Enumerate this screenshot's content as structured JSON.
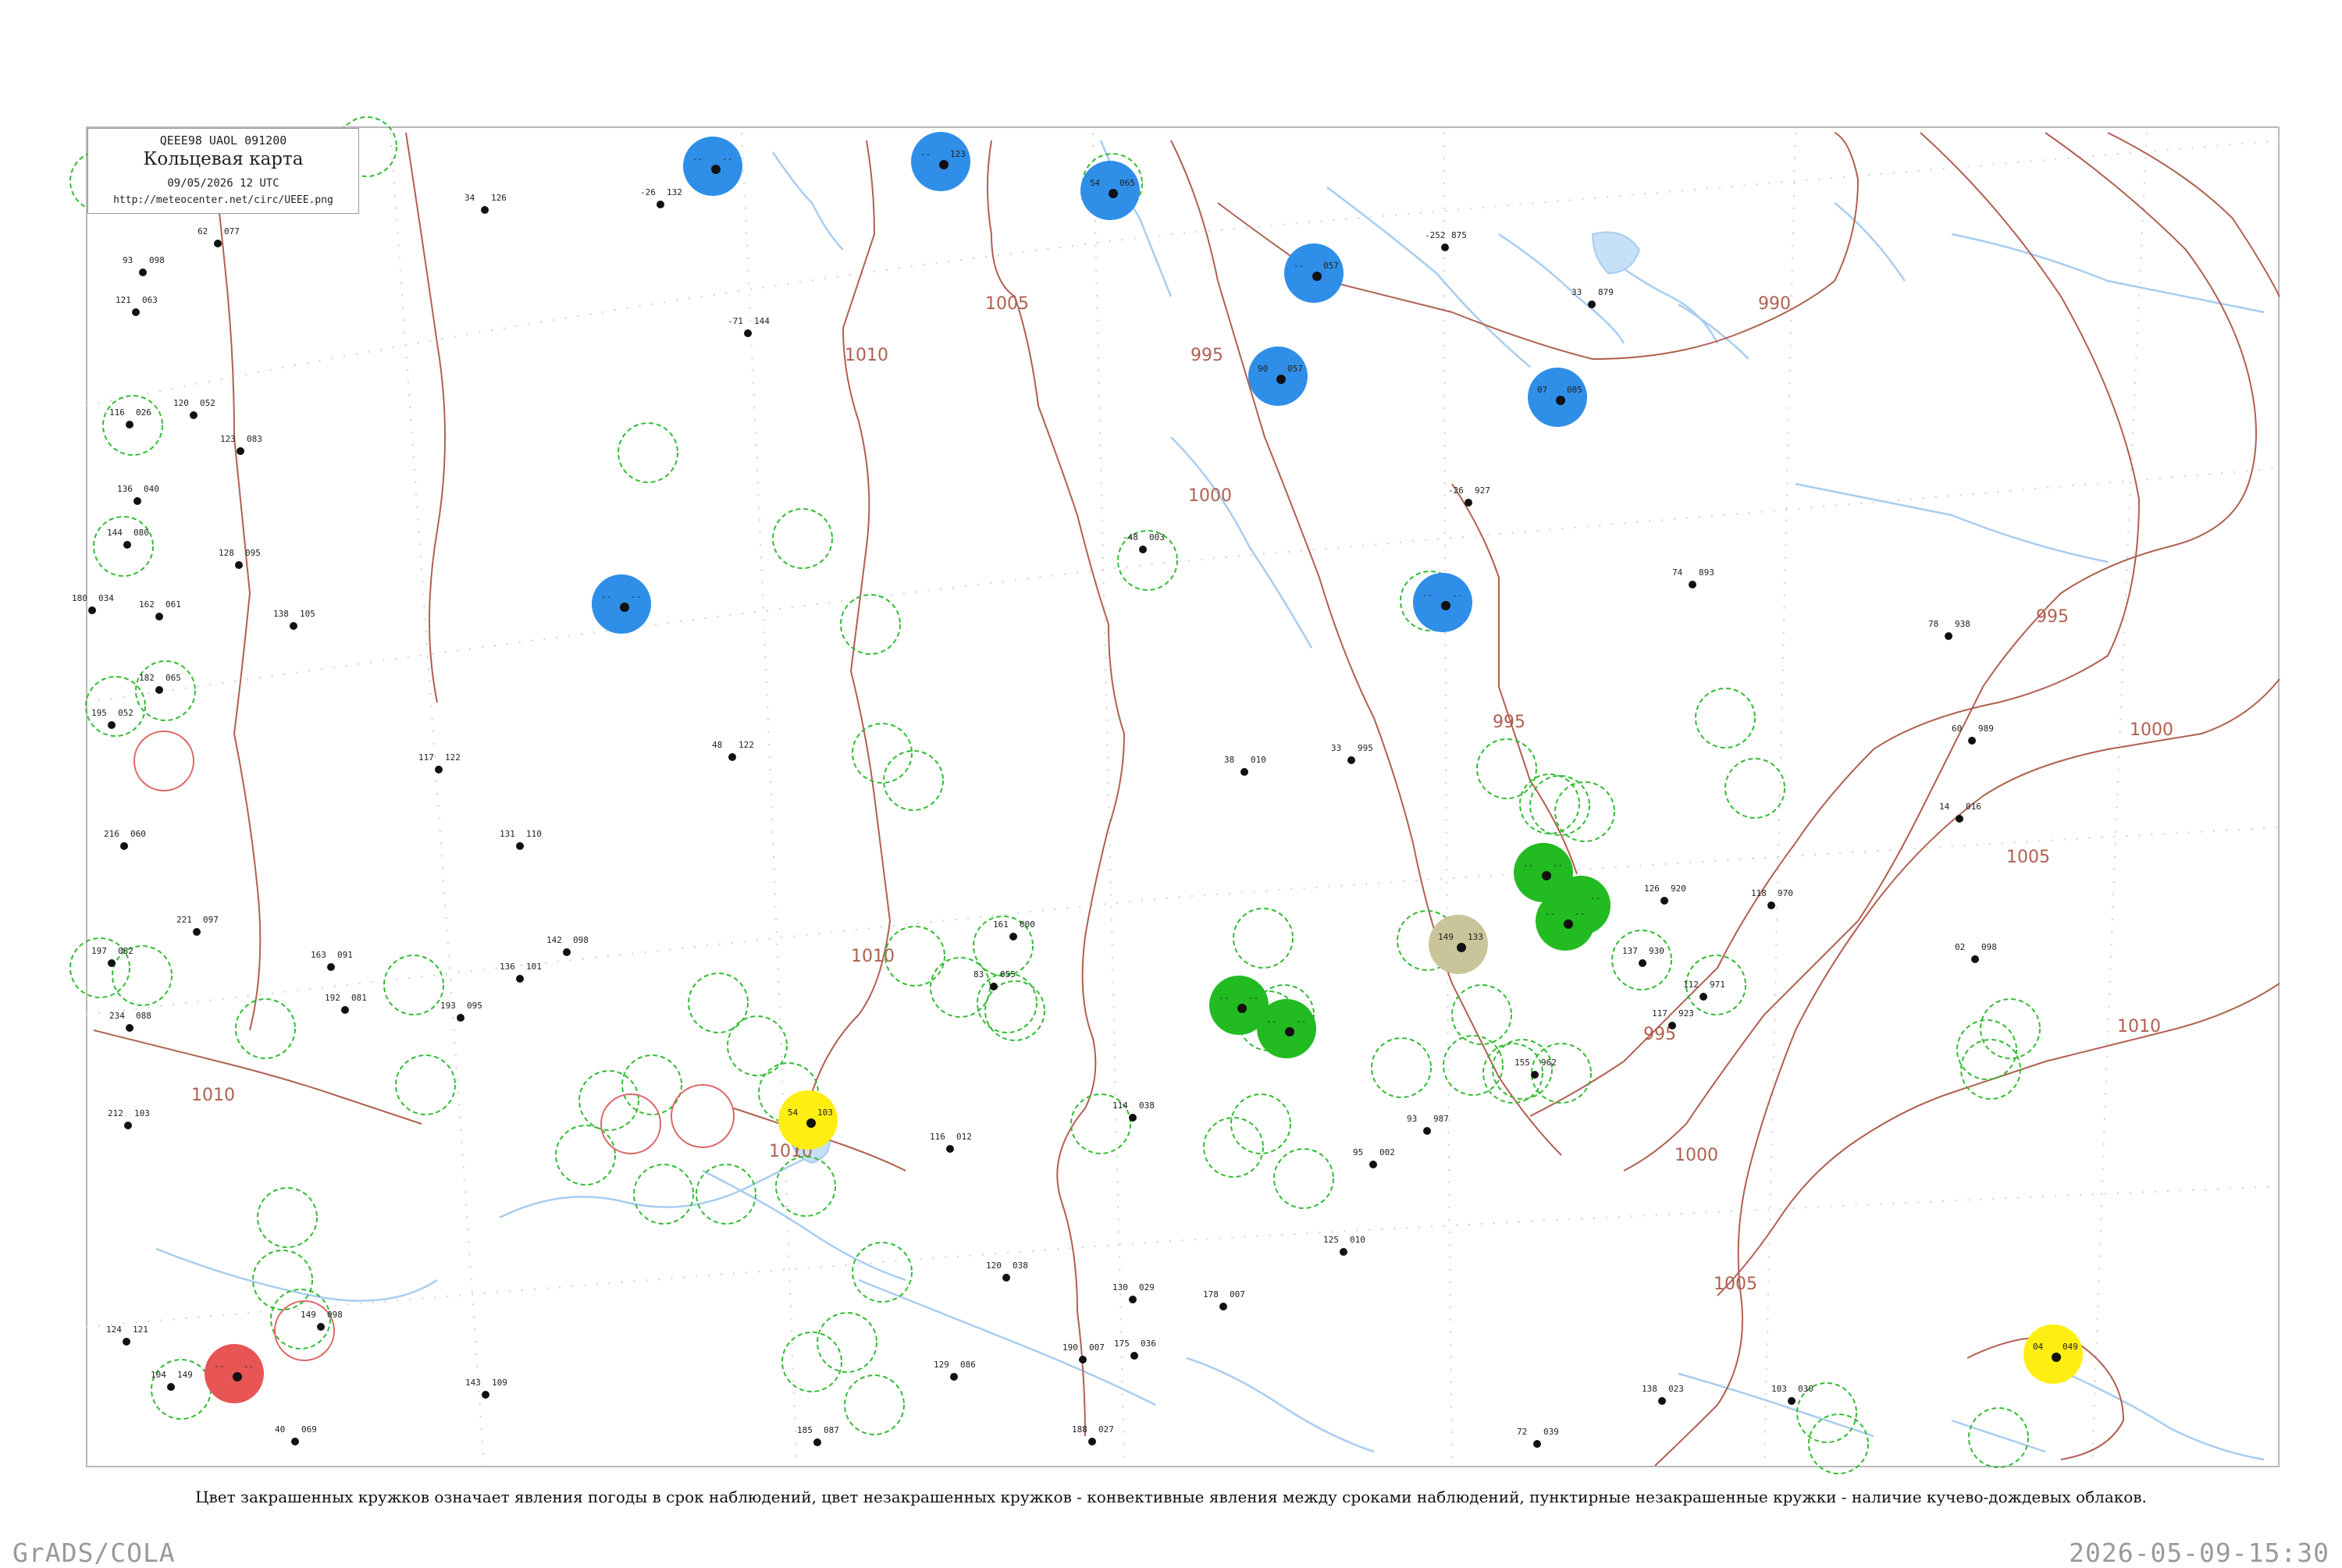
{
  "header": {
    "code_line": "QEEE98  UAOL  091200",
    "title": "Кольцевая карта",
    "date_line": "09/05/2026 12 UTC",
    "url": "http://meteocenter.net/circ/UEEE.png"
  },
  "caption": "Цвет закрашенных кружков означает явления погоды в срок наблюдений, цвет незакрашенных кружков - конвективные явления между сроками наблюдений, пунктирные незакрашенные кружки - наличие кучево-дождевых облаков.",
  "footer": {
    "left": "GrADS/COLA",
    "right": "2026-05-09-15:30"
  },
  "colors": {
    "isobar": "#b06050",
    "river": "#a8cdf0",
    "fill_blue": "#2f8fe8",
    "fill_green": "#22bb22",
    "fill_yellow": "#ffee11",
    "fill_red": "#e85555",
    "fill_khaki": "#c9c49a",
    "dashed_ring": "#33bb33",
    "convective_ring": "#dd6666"
  },
  "isobar_labels": [
    {
      "id": "iso-1005-a",
      "text": "1005"
    },
    {
      "id": "iso-1010-a",
      "text": "1010"
    },
    {
      "id": "iso-995-a",
      "text": "995"
    },
    {
      "id": "iso-990",
      "text": "990"
    },
    {
      "id": "iso-1000-a",
      "text": "1000"
    },
    {
      "id": "iso-995-b",
      "text": "995"
    },
    {
      "id": "iso-995-c",
      "text": "995"
    },
    {
      "id": "iso-1000-b",
      "text": "1000"
    },
    {
      "id": "iso-1005-b",
      "text": "1005"
    },
    {
      "id": "iso-1010-b",
      "text": "1010"
    },
    {
      "id": "iso-1010-c",
      "text": "1010"
    },
    {
      "id": "iso-1010-d",
      "text": "1010"
    },
    {
      "id": "iso-1000-c",
      "text": "1000"
    },
    {
      "id": "iso-1005-c",
      "text": "1005"
    },
    {
      "id": "iso-1010-e",
      "text": "1010"
    },
    {
      "id": "iso-995-d",
      "text": "995"
    }
  ],
  "stations": [
    {
      "id": "st-blue-1",
      "type": "filled",
      "color": "blue",
      "values": [
        "--",
        "--"
      ]
    },
    {
      "id": "st-blue-2",
      "type": "filled",
      "color": "blue",
      "values": [
        "--",
        "123"
      ]
    },
    {
      "id": "st-blue-3",
      "type": "filled",
      "color": "blue",
      "values": [
        "54",
        "065"
      ]
    },
    {
      "id": "st-blue-4",
      "type": "filled",
      "color": "blue",
      "values": [
        "--",
        "057"
      ]
    },
    {
      "id": "st-blue-5",
      "type": "filled",
      "color": "blue",
      "values": [
        "90",
        "057"
      ]
    },
    {
      "id": "st-blue-6",
      "type": "filled",
      "color": "blue",
      "values": [
        "07",
        "085"
      ]
    },
    {
      "id": "st-blue-7",
      "type": "filled",
      "color": "blue",
      "values": [
        "--",
        "--"
      ]
    },
    {
      "id": "st-blue-8",
      "type": "filled",
      "color": "blue",
      "values": [
        "--",
        "--"
      ]
    },
    {
      "id": "st-green-1",
      "type": "filled",
      "color": "green",
      "values": [
        "--",
        "--"
      ]
    },
    {
      "id": "st-green-2",
      "type": "filled",
      "color": "green",
      "values": [
        "--",
        "--"
      ]
    },
    {
      "id": "st-green-3",
      "type": "filled",
      "color": "green",
      "values": [
        "--",
        "--"
      ]
    },
    {
      "id": "st-green-4",
      "type": "filled",
      "color": "green",
      "values": [
        "--",
        "--"
      ]
    },
    {
      "id": "st-green-5",
      "type": "filled",
      "color": "green",
      "values": [
        "--",
        "--"
      ]
    },
    {
      "id": "st-yellow-1",
      "type": "filled",
      "color": "yellow",
      "values": [
        "54",
        "103"
      ]
    },
    {
      "id": "st-yellow-2",
      "type": "filled",
      "color": "yellow",
      "values": [
        "04",
        "049"
      ]
    },
    {
      "id": "st-red-1",
      "type": "filled",
      "color": "red",
      "values": [
        "--",
        "--"
      ]
    },
    {
      "id": "st-khaki-1",
      "type": "filled",
      "color": "khaki",
      "values": [
        "149",
        "133"
      ]
    }
  ],
  "station_numbers": [
    {
      "id": "sn-1",
      "top": "-26",
      "right": "132"
    },
    {
      "id": "sn-2",
      "top": "34",
      "right": "126"
    },
    {
      "id": "sn-3",
      "top": "62",
      "right": "077"
    },
    {
      "id": "sn-4",
      "top": "93",
      "right": "098"
    },
    {
      "id": "sn-5",
      "top": "121",
      "right": "063"
    },
    {
      "id": "sn-6",
      "top": "116",
      "right": "026"
    },
    {
      "id": "sn-7",
      "top": "120",
      "right": "052"
    },
    {
      "id": "sn-8",
      "top": "123",
      "right": "083"
    },
    {
      "id": "sn-9",
      "top": "136",
      "right": "040"
    },
    {
      "id": "sn-10",
      "top": "144",
      "right": "080"
    },
    {
      "id": "sn-11",
      "top": "128",
      "right": "095"
    },
    {
      "id": "sn-12",
      "top": "180",
      "right": "034"
    },
    {
      "id": "sn-13",
      "top": "162",
      "right": "061"
    },
    {
      "id": "sn-14",
      "top": "138",
      "right": "105"
    },
    {
      "id": "sn-15",
      "top": "182",
      "right": "065"
    },
    {
      "id": "sn-16",
      "top": "195",
      "right": "052"
    },
    {
      "id": "sn-17",
      "top": "216",
      "right": "060"
    },
    {
      "id": "sn-18",
      "top": "197",
      "right": "082"
    },
    {
      "id": "sn-19",
      "top": "234",
      "right": "088"
    },
    {
      "id": "sn-20",
      "top": "212",
      "right": "103"
    },
    {
      "id": "sn-21",
      "top": "221",
      "right": "097"
    },
    {
      "id": "sn-22",
      "top": "163",
      "right": "091"
    },
    {
      "id": "sn-23",
      "top": "192",
      "right": "081"
    },
    {
      "id": "sn-24",
      "top": "193",
      "right": "095"
    },
    {
      "id": "sn-25",
      "top": "136",
      "right": "101"
    },
    {
      "id": "sn-26",
      "top": "142",
      "right": "098"
    },
    {
      "id": "sn-27",
      "top": "131",
      "right": "110"
    },
    {
      "id": "sn-28",
      "top": "117",
      "right": "122"
    },
    {
      "id": "sn-29",
      "top": "48",
      "right": "122"
    },
    {
      "id": "sn-30",
      "top": "-71",
      "right": "144"
    },
    {
      "id": "sn-31",
      "top": "-48",
      "right": "003"
    },
    {
      "id": "sn-32",
      "top": "38",
      "right": "010"
    },
    {
      "id": "sn-33",
      "top": "33",
      "right": "995"
    },
    {
      "id": "sn-34",
      "top": "-26",
      "right": "927"
    },
    {
      "id": "sn-35",
      "top": "-252",
      "right": "875"
    },
    {
      "id": "sn-36",
      "top": "33",
      "right": "879"
    },
    {
      "id": "sn-37",
      "top": "74",
      "right": "893"
    },
    {
      "id": "sn-38",
      "top": "78",
      "right": "938"
    },
    {
      "id": "sn-39",
      "top": "60",
      "right": "989"
    },
    {
      "id": "sn-40",
      "top": "14",
      "right": "016"
    },
    {
      "id": "sn-41",
      "top": "02",
      "right": "098"
    },
    {
      "id": "sn-42",
      "top": "126",
      "right": "920"
    },
    {
      "id": "sn-43",
      "top": "118",
      "right": "970"
    },
    {
      "id": "sn-44",
      "top": "137",
      "right": "930"
    },
    {
      "id": "sn-45",
      "top": "112",
      "right": "971"
    },
    {
      "id": "sn-46",
      "top": "117",
      "right": "923"
    },
    {
      "id": "sn-47",
      "top": "155",
      "right": "962"
    },
    {
      "id": "sn-48",
      "top": "93",
      "right": "987"
    },
    {
      "id": "sn-49",
      "top": "95",
      "right": "002"
    },
    {
      "id": "sn-50",
      "top": "125",
      "right": "010"
    },
    {
      "id": "sn-51",
      "top": "161",
      "right": "000"
    },
    {
      "id": "sn-52",
      "top": "83",
      "right": "055"
    },
    {
      "id": "sn-53",
      "top": "114",
      "right": "038"
    },
    {
      "id": "sn-54",
      "top": "116",
      "right": "012"
    },
    {
      "id": "sn-55",
      "top": "120",
      "right": "038"
    },
    {
      "id": "sn-56",
      "top": "130",
      "right": "029"
    },
    {
      "id": "sn-57",
      "top": "178",
      "right": "007"
    },
    {
      "id": "sn-58",
      "top": "190",
      "right": "007"
    },
    {
      "id": "sn-59",
      "top": "188",
      "right": "027"
    },
    {
      "id": "sn-60",
      "top": "175",
      "right": "036"
    },
    {
      "id": "sn-61",
      "top": "138",
      "right": "023"
    },
    {
      "id": "sn-62",
      "top": "72",
      "right": "039"
    },
    {
      "id": "sn-63",
      "top": "103",
      "right": "030"
    },
    {
      "id": "sn-64",
      "top": "40",
      "right": "069"
    },
    {
      "id": "sn-65",
      "top": "149",
      "right": "098"
    },
    {
      "id": "sn-66",
      "top": "104",
      "right": "149"
    },
    {
      "id": "sn-67",
      "top": "124",
      "right": "121"
    },
    {
      "id": "sn-68",
      "top": "143",
      "right": "109"
    },
    {
      "id": "sn-69",
      "top": "185",
      "right": "087"
    },
    {
      "id": "sn-70",
      "top": "129",
      "right": "086"
    }
  ]
}
